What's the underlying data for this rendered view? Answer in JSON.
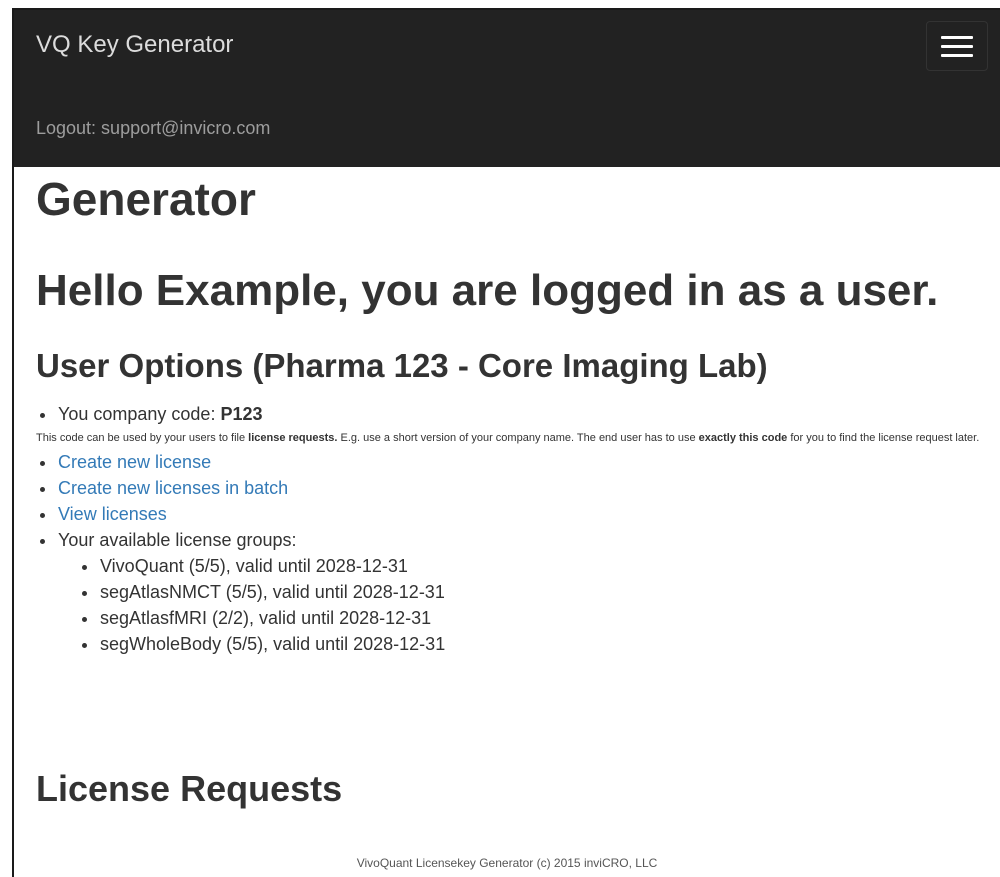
{
  "navbar": {
    "brand": "VQ Key Generator",
    "logout": "Logout: support@invicro.com",
    "toggle_icon": "menu-icon"
  },
  "page": {
    "title_fragment": "Generator",
    "greeting": "Hello Example, you are logged in as a user.",
    "options_title": "User Options (Pharma 123 - Core Imaging Lab)"
  },
  "company": {
    "label": "You company code: ",
    "code": "P123"
  },
  "note": {
    "part1": "This code can be used by your users to file ",
    "bold1": "license requests.",
    "part2": " E.g. use a short version of your company name. The end user has to use ",
    "bold2": "exactly this code",
    "part3": " for you to find the license request later."
  },
  "links": {
    "create_license": "Create new license",
    "create_batch": "Create new licenses in batch",
    "view_licenses": "View licenses"
  },
  "groups": {
    "label": "Your available license groups:",
    "items": [
      "VivoQuant (5/5), valid until 2028-12-31",
      "segAtlasNMCT (5/5), valid until 2028-12-31",
      "segAtlasfMRI (2/2), valid until 2028-12-31",
      "segWholeBody (5/5), valid until 2028-12-31"
    ]
  },
  "requests_title": "License Requests",
  "footer": "VivoQuant Licensekey Generator (c) 2015 inviCRO, LLC",
  "colors": {
    "navbar_bg": "#222222",
    "link": "#337ab7",
    "text": "#333333"
  }
}
